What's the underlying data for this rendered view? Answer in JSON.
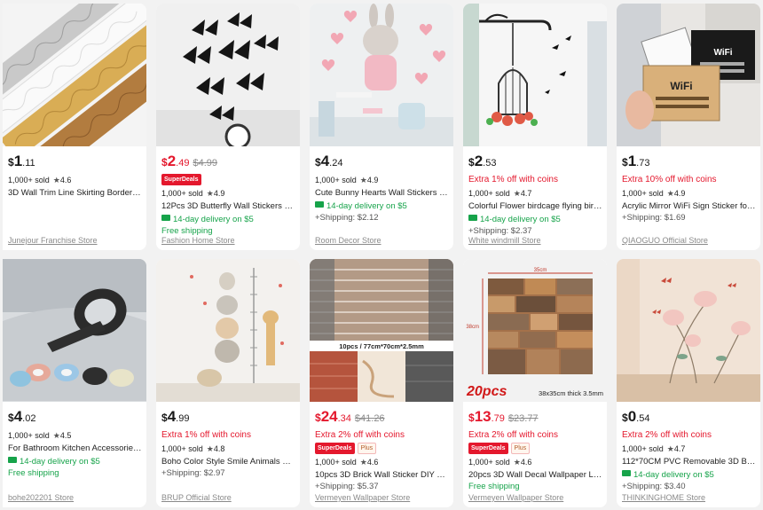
{
  "products": [
    {
      "id": "p1",
      "currency": "$",
      "whole": "1",
      "cents": ".11",
      "old": "",
      "promo": "",
      "superdeals": false,
      "plus": false,
      "sold": "1,000+ sold",
      "rating": "4.6",
      "title": "3D Wall Trim Line Skirting Border S...",
      "delivery": "",
      "free": "",
      "shipping": "",
      "store": "Junejour Franchise Store",
      "sale": false
    },
    {
      "id": "p2",
      "currency": "$",
      "whole": "2",
      "cents": ".49",
      "old": "$4.99",
      "promo": "",
      "superdeals": true,
      "plus": false,
      "sold": "1,000+ sold",
      "rating": "4.9",
      "title": "12Pcs 3D Butterfly Wall Stickers PV...",
      "delivery": "14-day delivery on $5",
      "free": "Free shipping",
      "shipping": "",
      "store": "Fashion Home Store",
      "sale": true
    },
    {
      "id": "p3",
      "currency": "$",
      "whole": "4",
      "cents": ".24",
      "old": "",
      "promo": "",
      "superdeals": false,
      "plus": false,
      "sold": "1,000+ sold",
      "rating": "4.9",
      "title": "Cute Bunny Hearts Wall Stickers for...",
      "delivery": "14-day delivery on $5",
      "free": "",
      "shipping": "+Shipping: $2.12",
      "store": "Room Decor Store",
      "sale": false
    },
    {
      "id": "p4",
      "currency": "$",
      "whole": "2",
      "cents": ".53",
      "old": "",
      "promo": "Extra 1% off with coins",
      "superdeals": false,
      "plus": false,
      "sold": "1,000+ sold",
      "rating": "4.7",
      "title": "Colorful Flower birdcage flying bird...",
      "delivery": "14-day delivery on $5",
      "free": "",
      "shipping": "+Shipping: $2.37",
      "store": "White windmill Store",
      "sale": false
    },
    {
      "id": "p5",
      "currency": "$",
      "whole": "1",
      "cents": ".73",
      "old": "",
      "promo": "Extra 10% off with coins",
      "superdeals": false,
      "plus": false,
      "sold": "1,000+ sold",
      "rating": "4.9",
      "title": "Acrylic Mirror WiFi Sign Sticker for ...",
      "delivery": "",
      "free": "",
      "shipping": "+Shipping: $1.69",
      "store": "QIAOGUO Official Store",
      "sale": false
    },
    {
      "id": "p6",
      "currency": "$",
      "whole": "4",
      "cents": ".02",
      "old": "",
      "promo": "",
      "superdeals": false,
      "plus": false,
      "sold": "1,000+ sold",
      "rating": "4.5",
      "title": "For Bathroom Kitchen Accessories ...",
      "delivery": "14-day delivery on $5",
      "free": "Free shipping",
      "shipping": "",
      "store": "bohe202201 Store",
      "sale": false
    },
    {
      "id": "p7",
      "currency": "$",
      "whole": "4",
      "cents": ".99",
      "old": "",
      "promo": "Extra 1% off with coins",
      "superdeals": false,
      "plus": false,
      "sold": "1,000+ sold",
      "rating": "4.8",
      "title": "Boho Color Style Smile Animals Bea...",
      "delivery": "",
      "free": "",
      "shipping": "+Shipping: $2.97",
      "store": "BRUP Official Store",
      "sale": false
    },
    {
      "id": "p8",
      "currency": "$",
      "whole": "24",
      "cents": ".34",
      "old": "$41.26",
      "promo": "Extra 2% off with coins",
      "superdeals": true,
      "plus": true,
      "sold": "1,000+ sold",
      "rating": "4.6",
      "title": "10pcs 3D Brick Wall Sticker DIY Wal...",
      "delivery": "",
      "free": "",
      "shipping": "+Shipping: $5.37",
      "store": "Vermeyen Wallpaper Store",
      "sale": true
    },
    {
      "id": "p9",
      "currency": "$",
      "whole": "13",
      "cents": ".79",
      "old": "$23.77",
      "promo": "Extra 2% off with coins",
      "superdeals": true,
      "plus": true,
      "sold": "1,000+ sold",
      "rating": "4.6",
      "title": "20pcs 3D Wall Decal Wallpaper Livi...",
      "delivery": "",
      "free": "Free shipping",
      "shipping": "",
      "store": "Vermeyen Wallpaper Store",
      "sale": true
    },
    {
      "id": "p10",
      "currency": "$",
      "whole": "0",
      "cents": ".54",
      "old": "",
      "promo": "Extra 2% off with coins",
      "superdeals": false,
      "plus": false,
      "sold": "1,000+ sold",
      "rating": "4.7",
      "title": "112*70CM PVC Removable 3D Butt...",
      "delivery": "14-day delivery on $5",
      "free": "",
      "shipping": "+Shipping: $3.40",
      "store": "THINKINGHOME Store",
      "sale": false
    }
  ],
  "badges": {
    "superdeals": "SuperDeals",
    "plus": "Plus"
  },
  "image_text": {
    "wifi_left": "WiFi",
    "wifi_right": "WiFi",
    "brick_label": "10pcs / 77cm*70cm*2.5mm",
    "tile_count": "20pcs",
    "tile_size": "38x35cm thick 3.5mm",
    "tile_w": "35cm",
    "tile_h": "38cm"
  },
  "colors": {
    "sale": "#e4182d",
    "delivery": "#16a34a",
    "muted": "#8a8a8a"
  }
}
